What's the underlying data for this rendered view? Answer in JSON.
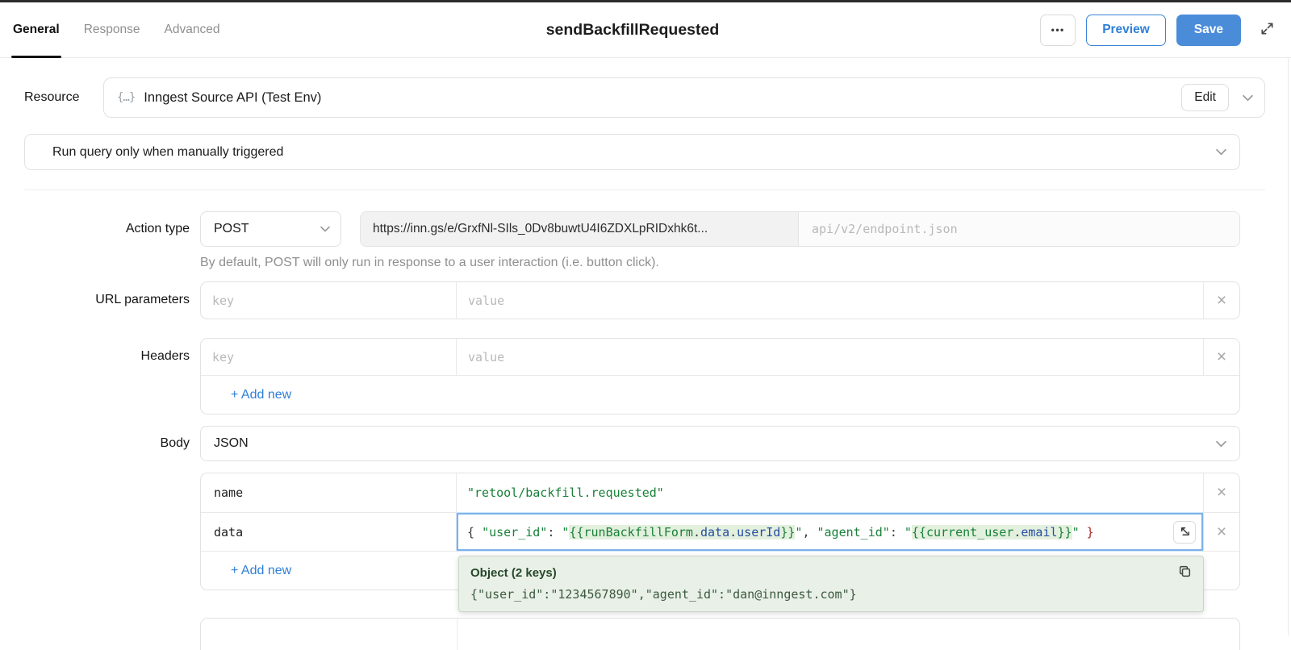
{
  "icons": {
    "more": "•••",
    "close": "×",
    "braces": "{…}"
  },
  "header": {
    "tabs": [
      {
        "label": "General"
      },
      {
        "label": "Response"
      },
      {
        "label": "Advanced"
      }
    ],
    "title": "sendBackfillRequested",
    "preview_label": "Preview",
    "save_label": "Save"
  },
  "resource": {
    "label": "Resource",
    "value": "Inngest Source API (Test Env)",
    "edit_label": "Edit"
  },
  "trigger": {
    "value": "Run query only when manually triggered"
  },
  "action": {
    "label": "Action type",
    "method": "POST",
    "base_url": "https://inn.gs/e/GrxfNl-SIls_0Dv8buwtU4I6ZDXLpRIDxhk6t...",
    "path_placeholder": "api/v2/endpoint.json",
    "hint": "By default, POST will only run in response to a user interaction (i.e. button click)."
  },
  "url_params": {
    "label": "URL parameters",
    "key_placeholder": "key",
    "value_placeholder": "value"
  },
  "headers": {
    "label": "Headers",
    "key_placeholder": "key",
    "value_placeholder": "value",
    "add_new_label": "+ Add new"
  },
  "body": {
    "label": "Body",
    "type_value": "JSON",
    "add_new_label": "+ Add new",
    "rows": [
      {
        "key": "name",
        "value": "\"retool/backfill.requested\""
      },
      {
        "key": "data"
      }
    ],
    "data_tokens": [
      {
        "text": "{ ",
        "style": "plain"
      },
      {
        "text": "\"user_id\"",
        "style": "green"
      },
      {
        "text": ": ",
        "style": "plain"
      },
      {
        "text": "\"",
        "style": "green"
      },
      {
        "text": "{{runBackfillForm",
        "style": "green",
        "hl": true
      },
      {
        "text": ".",
        "style": "plain",
        "hl": true
      },
      {
        "text": "data",
        "style": "blue",
        "hl": true
      },
      {
        "text": ".",
        "style": "plain",
        "hl": true
      },
      {
        "text": "userId",
        "style": "blue",
        "hl": true
      },
      {
        "text": "}}",
        "style": "green",
        "hl": true
      },
      {
        "text": "\"",
        "style": "green"
      },
      {
        "text": ", ",
        "style": "plain"
      },
      {
        "text": "\"agent_id\"",
        "style": "green"
      },
      {
        "text": ": ",
        "style": "plain"
      },
      {
        "text": "\"",
        "style": "green"
      },
      {
        "text": "{{current_user",
        "style": "green",
        "hl": true
      },
      {
        "text": ".",
        "style": "plain",
        "hl": true
      },
      {
        "text": "email",
        "style": "blue",
        "hl": true
      },
      {
        "text": "}}",
        "style": "green",
        "hl": true
      },
      {
        "text": "\"",
        "style": "green"
      },
      {
        "text": " ",
        "style": "plain"
      },
      {
        "text": "}",
        "style": "red"
      }
    ]
  },
  "evaluation_popup": {
    "title": "Object (2 keys)",
    "value": "{\"user_id\":\"1234567890\",\"agent_id\":\"dan@inngest.com\"}"
  },
  "colors": {
    "accent_blue": "#2f7fd6",
    "save_blue": "#4b8cd9",
    "code_green": "#188038",
    "code_blue": "#274da1",
    "code_red": "#a82a2a",
    "template_highlight": "#e3f0de",
    "popup_bg": "#e9f0e7"
  }
}
